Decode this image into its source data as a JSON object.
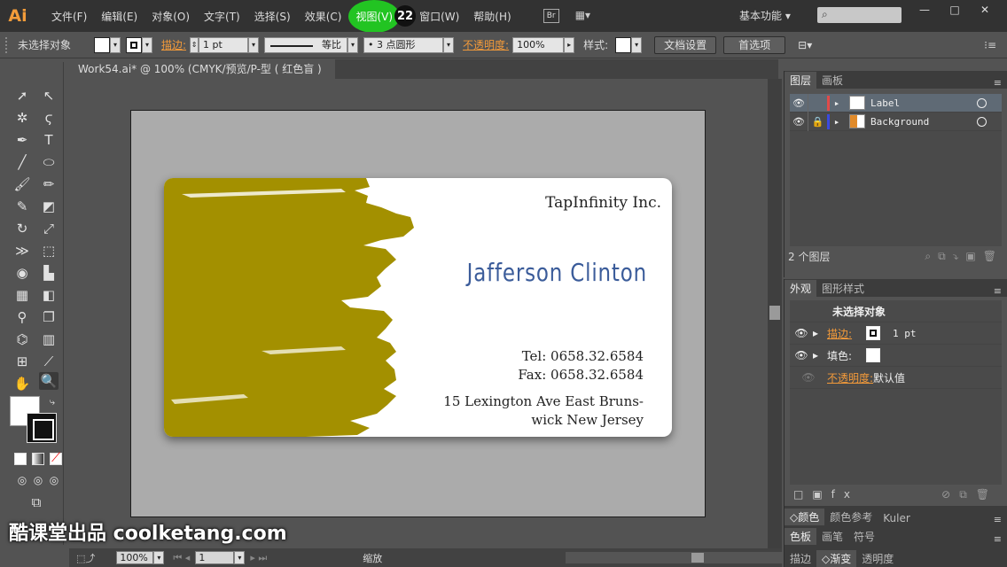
{
  "app": {
    "logo": "Ai"
  },
  "menu": {
    "items": [
      "文件(F)",
      "编辑(E)",
      "对象(O)",
      "文字(T)",
      "选择(S)",
      "效果(C)",
      "视图(V)",
      "窗口(W)",
      "帮助(H)"
    ],
    "highlight_badge": "22",
    "bridge_label": "Br",
    "workspace": "基本功能"
  },
  "window_controls": {
    "minimize": "—",
    "restore": "□",
    "close": "✕"
  },
  "control_bar": {
    "selection": "未选择对象",
    "stroke_label": "描边:",
    "stroke_weight": "1 pt",
    "profile": "等比",
    "brush": "3 点圆形",
    "opacity_label": "不透明度:",
    "opacity": "100%",
    "style_label": "样式:",
    "doc_setup": "文档设置",
    "preferences": "首选项"
  },
  "document": {
    "tab_title": "Work54.ai* @ 100% (CMYK/预览/P-型 ( 红色盲 ) )",
    "tab_close": "✕"
  },
  "card": {
    "company": "TapInfinity Inc.",
    "name": "Jafferson Clinton",
    "tel": "Tel: 0658.32.6584",
    "fax": "Fax: 0658.32.6584",
    "address_line1": "15 Lexington Ave East Bruns-",
    "address_line2": "wick New Jersey",
    "paint_color": "#a39000"
  },
  "layers_panel": {
    "tabs": [
      "图层",
      "画板"
    ],
    "layers": [
      {
        "name": "Label",
        "color": "#e04a4a"
      },
      {
        "name": "Background",
        "color": "#3a4ae0"
      }
    ],
    "count": "2 个图层"
  },
  "appearance_panel": {
    "tabs": [
      "外观",
      "图形样式"
    ],
    "title": "未选择对象",
    "stroke_label": "描边:",
    "stroke_value": "1 pt",
    "fill_label": "填色:",
    "opacity_label": "不透明度:",
    "opacity_value": "默认值"
  },
  "collapsed_panels": [
    [
      "颜色",
      "颜色参考",
      "Kuler"
    ],
    [
      "色板",
      "画笔",
      "符号"
    ],
    [
      "描边",
      "渐变",
      "透明度"
    ]
  ],
  "status_bar": {
    "zoom": "100%",
    "page": "1",
    "tool": "缩放"
  },
  "watermark": "酷课堂出品 coolketang.com"
}
